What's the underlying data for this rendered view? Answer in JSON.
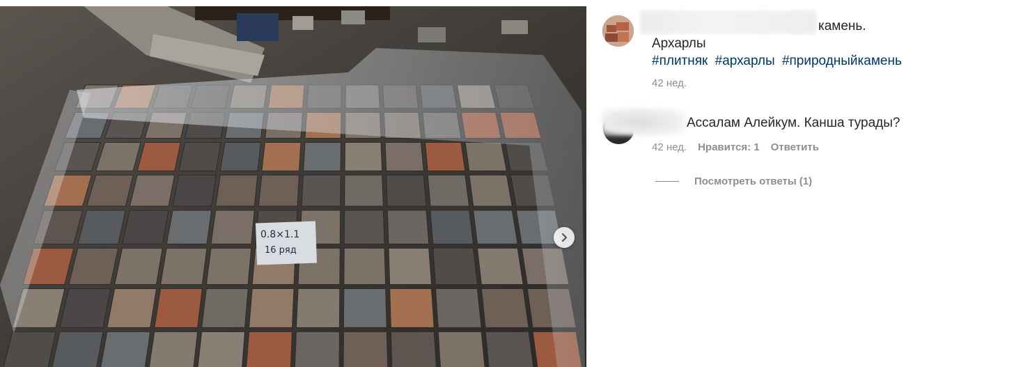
{
  "post": {
    "caption_tail": "камень.",
    "caption_line2": "Архарлы",
    "hashtags": [
      "#плитняк",
      "#архарлы",
      "#природныйкамень"
    ],
    "time": "42 нед."
  },
  "photo": {
    "label_line1": "0.8×1.1",
    "label_line2": "16 ряд"
  },
  "comment": {
    "text": "Ассалам Алейкум. Канша турады?",
    "time": "42 нед.",
    "likes": "Нравится: 1",
    "reply": "Ответить"
  },
  "replies": {
    "label": "Посмотреть ответы (1)"
  },
  "icons": {
    "next": "chevron-right-icon"
  },
  "colors": {
    "link": "#00376b",
    "text": "#262626",
    "muted": "#8e8e8e"
  }
}
